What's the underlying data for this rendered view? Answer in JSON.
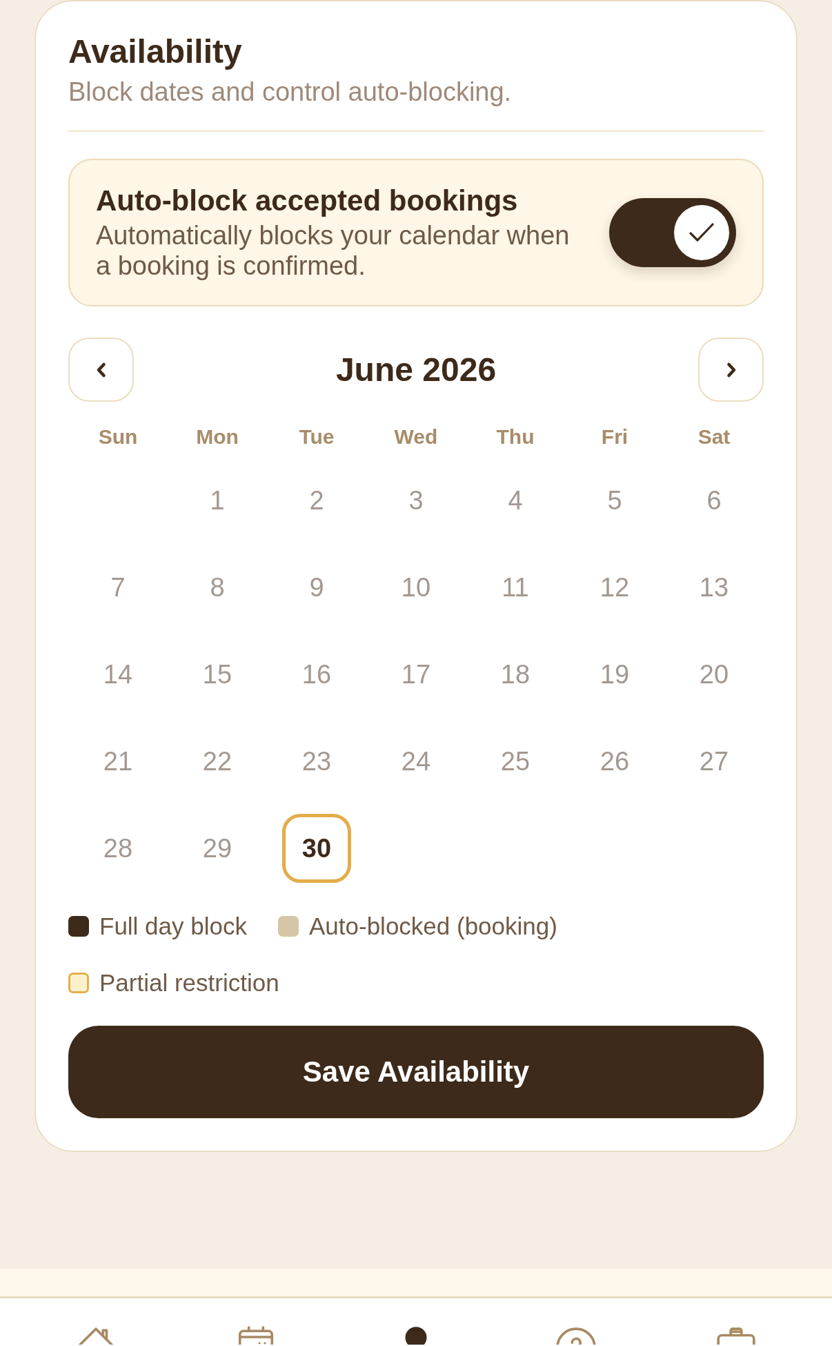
{
  "card": {
    "title": "Availability",
    "subtitle": "Block dates and control auto-blocking."
  },
  "auto_block": {
    "title": "Auto-block accepted bookings",
    "description": "Automatically blocks your calendar when a booking is confirmed.",
    "on": true
  },
  "calendar": {
    "month": "June 2026",
    "weekdays": [
      "Sun",
      "Mon",
      "Tue",
      "Wed",
      "Thu",
      "Fri",
      "Sat"
    ],
    "weeks": [
      [
        {
          "label": "1",
          "selected": false
        },
        {
          "label": "2",
          "selected": false
        },
        {
          "label": "3",
          "selected": false
        },
        {
          "label": "4",
          "selected": false
        },
        {
          "label": "5",
          "selected": false
        },
        {
          "label": "6",
          "selected": false
        }
      ],
      [
        {
          "label": "7",
          "selected": false
        },
        {
          "label": "8",
          "selected": false
        },
        {
          "label": "9",
          "selected": false
        },
        {
          "label": "10",
          "selected": false
        },
        {
          "label": "11",
          "selected": false
        },
        {
          "label": "12",
          "selected": false
        },
        {
          "label": "13",
          "selected": false
        }
      ],
      [
        {
          "label": "14",
          "selected": false
        },
        {
          "label": "15",
          "selected": false
        },
        {
          "label": "16",
          "selected": false
        },
        {
          "label": "17",
          "selected": false
        },
        {
          "label": "18",
          "selected": false
        },
        {
          "label": "19",
          "selected": false
        },
        {
          "label": "20",
          "selected": false
        }
      ],
      [
        {
          "label": "21",
          "selected": false
        },
        {
          "label": "22",
          "selected": false
        },
        {
          "label": "23",
          "selected": false
        },
        {
          "label": "24",
          "selected": false
        },
        {
          "label": "25",
          "selected": false
        },
        {
          "label": "26",
          "selected": false
        },
        {
          "label": "27",
          "selected": false
        }
      ],
      [
        {
          "label": "28",
          "selected": false
        },
        {
          "label": "29",
          "selected": false
        },
        {
          "label": "30",
          "selected": true
        }
      ]
    ]
  },
  "legend": [
    {
      "label": "Full day block",
      "kind": "solid",
      "color": "#3d2a1a"
    },
    {
      "label": "Auto-blocked (booking)",
      "kind": "solid",
      "color": "#d6c6a7"
    },
    {
      "label": "Partial restriction",
      "kind": "outline",
      "color": "#e3af4b"
    }
  ],
  "save_button": {
    "label": "Save Availability"
  },
  "bottom_nav": [
    {
      "kind": "home",
      "selected": false
    },
    {
      "kind": "calendar",
      "selected": false
    },
    {
      "kind": "profile",
      "selected": true
    },
    {
      "kind": "help",
      "selected": false
    },
    {
      "kind": "briefcase",
      "selected": false
    }
  ]
}
